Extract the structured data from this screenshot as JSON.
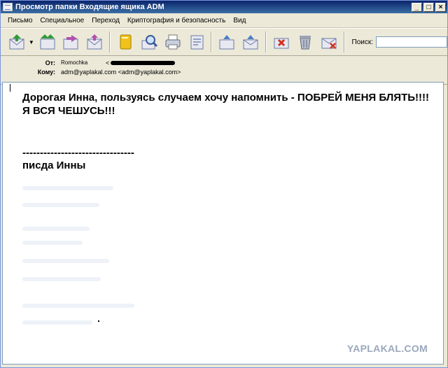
{
  "window": {
    "title": "Просмотр папки Входящие ящика ADM"
  },
  "menu": [
    "Письмо",
    "Специальное",
    "Переход",
    "Криптография и безопасность",
    "Вид"
  ],
  "toolbar": {
    "buttons": [
      "reply-icon",
      "reply-all-icon",
      "forward-icon",
      "send-icon",
      "address-book-icon",
      "find-icon",
      "print-icon",
      "properties-icon",
      "move-icon",
      "copy-icon",
      "junk-icon",
      "delete-icon",
      "close-icon"
    ],
    "search_label": "Поиск:",
    "search_value": ""
  },
  "headers": {
    "from_label": "От:",
    "from_value": "Romochka",
    "from_addr_prefix": "<",
    "to_label": "Кому:",
    "to_value": "adm@yaplakal.com <adm@yaplakal.com>"
  },
  "message": {
    "line1": "Дорогая Инна, пользуясь случаем хочу напомнить - ПОБРЕЙ МЕНЯ БЛЯТЬ!!!! Я ВСЯ ЧЕШУСЬ!!!",
    "separator": "--------------------------------",
    "signature": "писда Инны"
  },
  "watermark": "YAPLAKAL.COM"
}
